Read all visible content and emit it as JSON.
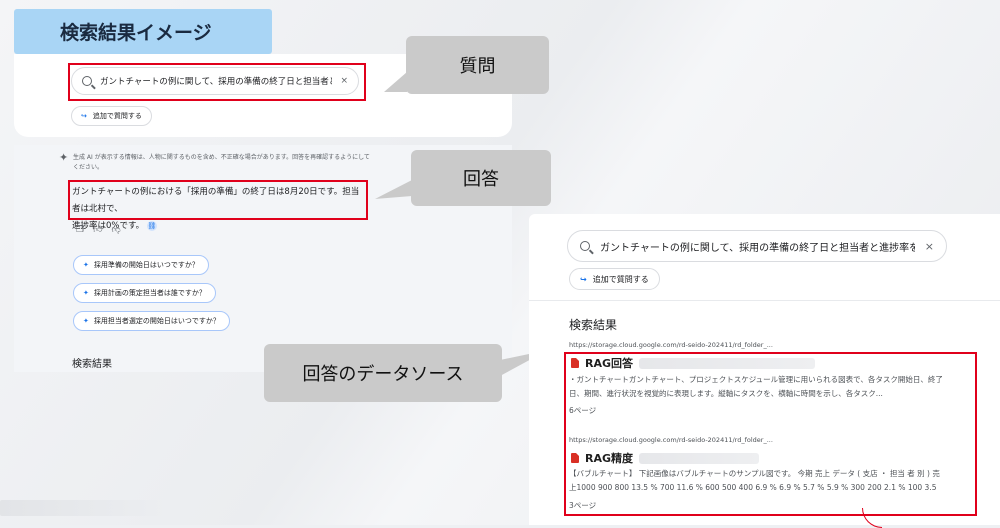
{
  "title_tag": "検索結果イメージ",
  "left": {
    "search_query": "ガントチャートの例に関して、採用の準備の終了日と担当者と進捗率を教えて",
    "close_symbol": "×",
    "follow_up_label": "追加で質問する",
    "disclaimer": "生成 AI が表示する情報は、人物に関するものを含め、不正確な場合があります。回答を再確認するようにしてください。",
    "answer_line1": "ガントチャートの例における「採用の準備」の終了日は8月20日です。担当者は北村で、",
    "answer_line2": "進捗率は0%です。",
    "suggestions": [
      "採用準備の開始日はいつですか？",
      "採用計画の策定担当者は誰ですか？",
      "採用担当者選定の開始日はいつですか？"
    ],
    "results_label": "検索結果"
  },
  "callouts": {
    "question": "質問",
    "answer": "回答",
    "source": "回答のデータソース"
  },
  "right": {
    "search_query": "ガントチャートの例に関して、採用の準備の終了日と担当者と進捗率を教えて",
    "close_symbol": "×",
    "follow_up_label": "追加で質問する",
    "results_title": "検索結果",
    "results": [
      {
        "url": "https://storage.cloud.google.com/rd-seido-202411/rd_folder_...",
        "title": "RAG回答",
        "snippet": "・ガントチャートガントチャート、プロジェクトスケジュール管理に用いられる図表で、各タスク開始日、終了日、期間、進行状況を視覚的に表現します。縦軸にタスクを、横軸に時間を示し、各タスク...",
        "pages": "6ページ"
      },
      {
        "url": "https://storage.cloud.google.com/rd-seido-202411/rd_folder_...",
        "title": "RAG精度",
        "snippet": "【バブルチャート】 下記画像はバブルチャートのサンプル図です。 今期 売上 データ ( 支店 ・ 担当 者 別 ) 売 上1000 900 800 13.5 % 700 11.6 % 600 500 400 6.9 % 6.9 % 5.7 % 5.9 % 300 200 2.1 % 100 3.5 %...",
        "pages": "3ページ"
      }
    ]
  },
  "icons": {
    "feedback": [
      "copy-icon",
      "thumbs-up-icon",
      "thumbs-down-icon"
    ]
  },
  "colors": {
    "highlight_red": "#e0001b",
    "title_tag_bg": "#a9d5f5",
    "callout_bg": "#cacaca",
    "accent_blue": "#1a73e8"
  }
}
